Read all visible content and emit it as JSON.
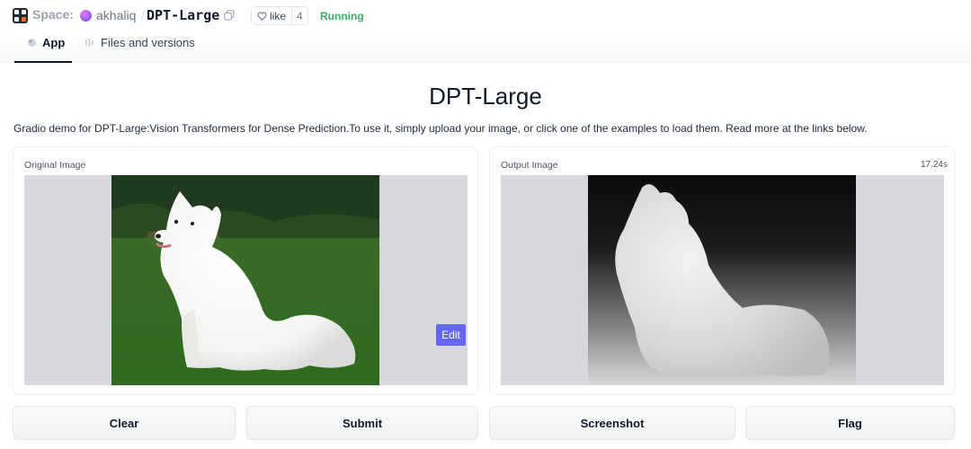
{
  "header": {
    "space_label": "Space:",
    "owner": "akhaliq",
    "separator": "/",
    "repo_name": "DPT-Large",
    "like_label": "like",
    "like_count": "4",
    "status": "Running"
  },
  "tabs": [
    {
      "label": "App",
      "active": true,
      "icon": "app-icon"
    },
    {
      "label": "Files and versions",
      "active": false,
      "icon": "files-icon"
    }
  ],
  "main": {
    "title": "DPT-Large",
    "description": "Gradio demo for DPT-Large:Vision Transformers for Dense Prediction.To use it, simply upload your image, or click one of the examples to load them. Read more at the links below."
  },
  "input_panel": {
    "label": "Original Image",
    "edit_label": "Edit"
  },
  "output_panel": {
    "label": "Output Image",
    "elapsed": "17.24s"
  },
  "buttons": {
    "clear": "Clear",
    "submit": "Submit",
    "screenshot": "Screenshot",
    "flag": "Flag"
  },
  "colors": {
    "accent": "#6366f1",
    "status": "#16a34a"
  }
}
